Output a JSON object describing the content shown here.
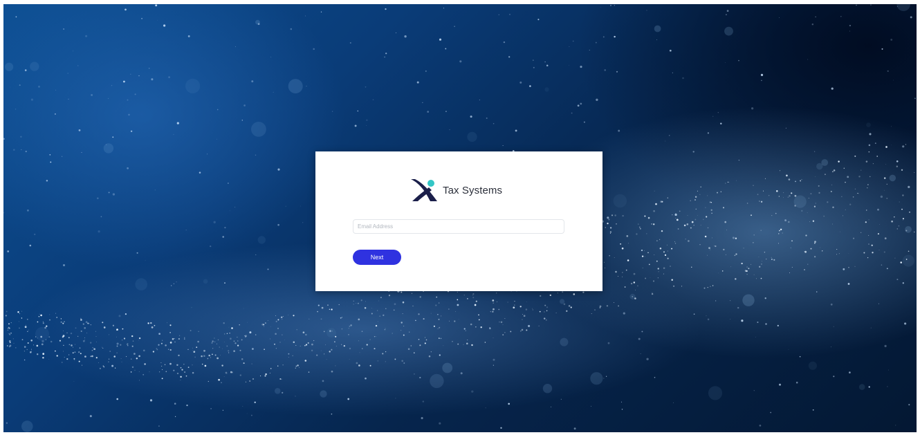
{
  "brand": {
    "name": "Tax Systems",
    "logo_icon": "x-logo-icon",
    "colors": {
      "mark_dark": "#1b1f4a",
      "mark_dot": "#33c6c6"
    }
  },
  "login": {
    "email_placeholder": "Email Address",
    "email_value": "",
    "next_label": "Next"
  },
  "colors": {
    "button": "#2f32e0",
    "background_dark": "#041833",
    "background_light": "#0d4f93"
  },
  "background": {
    "description_icon": "particle-wave-background"
  }
}
